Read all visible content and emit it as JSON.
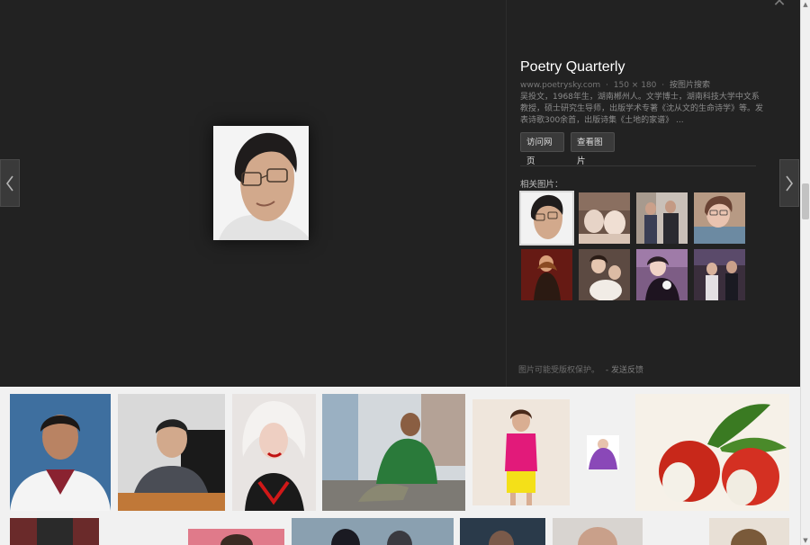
{
  "viewer": {
    "close_icon": "close-icon",
    "prev_icon": "chevron-left-icon",
    "next_icon": "chevron-right-icon",
    "bg_color": "#222222"
  },
  "panel": {
    "title": "Poetry Quarterly",
    "source_domain": "www.poetrysky.com",
    "dimensions": "150 × 180",
    "search_by_image": "按图片搜索",
    "description": "吴投文，1968年生，湖南郴州人。文学博士，湖南科技大学中文系教授，硕士研究生导师，出版学术专著《沈从文的生命诗学》等。发表诗歌300余首，出版诗集《土地的家谱》 ...",
    "visit_button": "访问网页",
    "view_button": "查看图片",
    "related_label": "相关图片：",
    "copyright_notice": "图片可能受版权保护。",
    "feedback_link": "- 发送反馈",
    "related_count": 8
  },
  "results_count": 13
}
